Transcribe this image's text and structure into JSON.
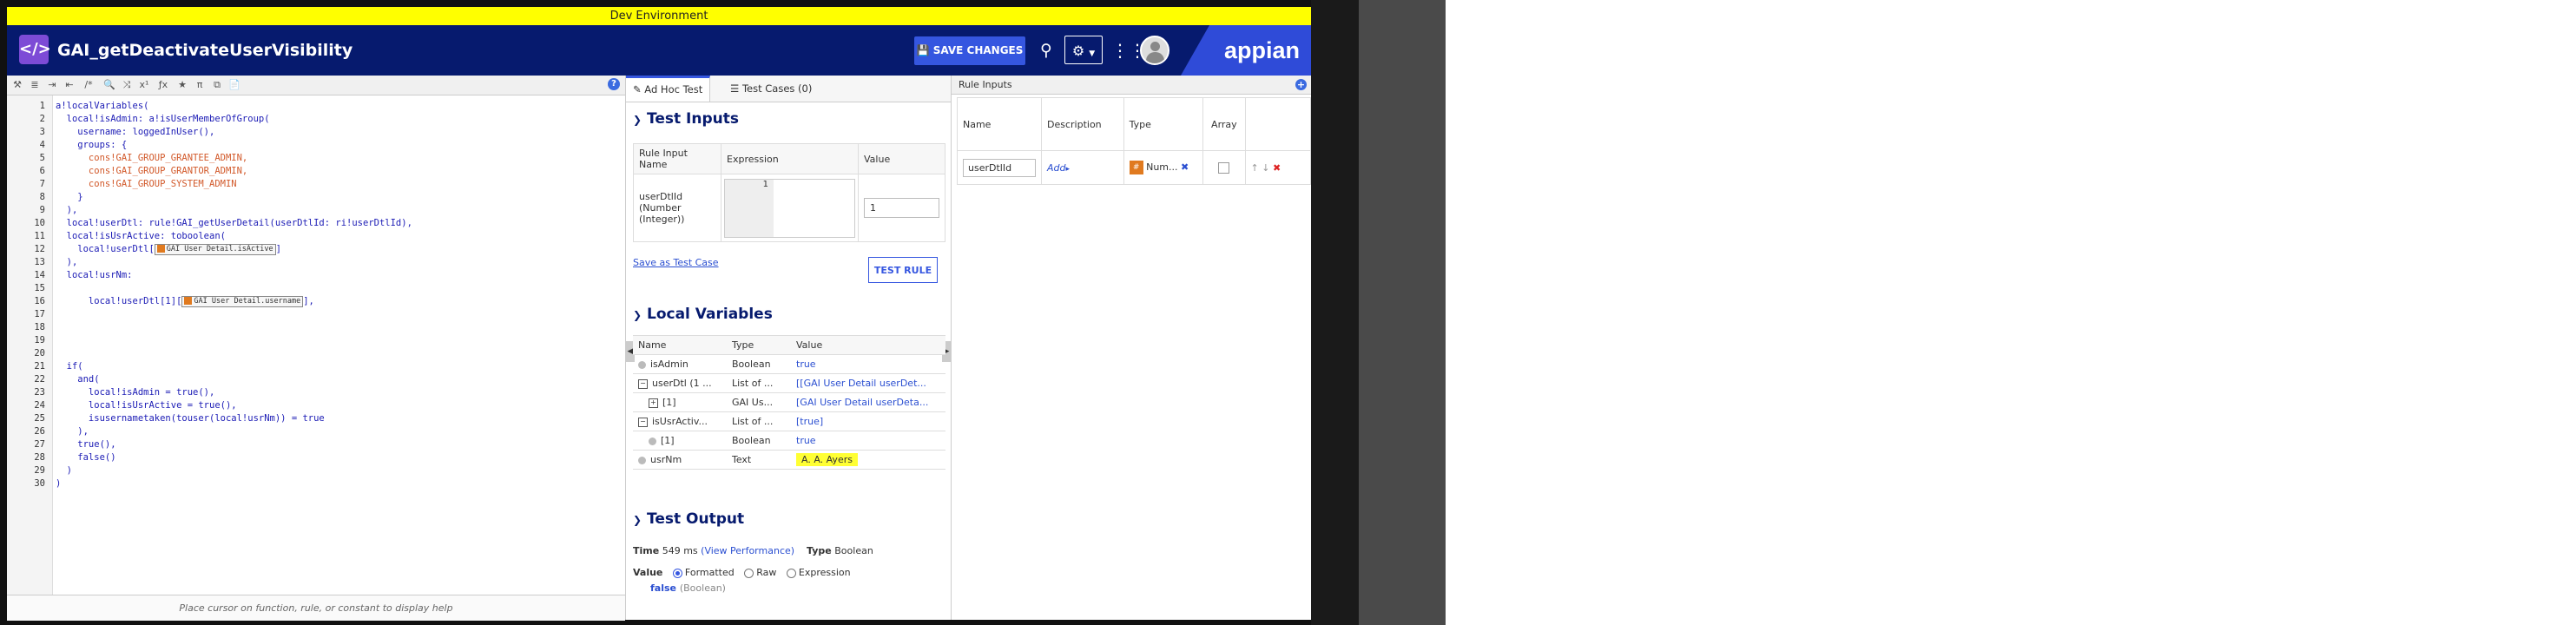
{
  "env_banner": "Dev Environment",
  "header": {
    "logo_glyph": "</>",
    "title": "GAI_getDeactivateUserVisibility",
    "save_label": "SAVE CHANGES",
    "brand": "appian",
    "colors": {
      "header_bg": "#061a6e",
      "accent": "#3556e0",
      "logo": "#7d4bd6",
      "env_banner": "#ffff00"
    }
  },
  "editor": {
    "toolbar_icons": [
      "tools-icon",
      "format-icon",
      "indent-icon",
      "outdent-icon",
      "comment-icon",
      "search-icon",
      "shuffle-icon",
      "text-size-icon",
      "function-icon",
      "star-icon",
      "pi-icon",
      "test-icon",
      "document-icon"
    ],
    "toolbar_glyphs": [
      "⚒",
      "≣",
      "⇥",
      "⇤",
      "/*",
      "🔍",
      "⤨",
      "x¹",
      "ƒx",
      "★",
      "π",
      "⧉",
      "📄"
    ],
    "help_glyph": "?",
    "line_numbers": [
      "1",
      "2",
      "3",
      "4",
      "5",
      "6",
      "7",
      "8",
      "9",
      "10",
      "11",
      "12",
      "13",
      "14",
      "15",
      "16",
      "17",
      "18",
      "19",
      "20",
      "21",
      "22",
      "23",
      "24",
      "25",
      "26",
      "27",
      "28",
      "29",
      "30"
    ],
    "lines": {
      "l1": "a!localVariables(",
      "l2": "  local!isAdmin: a!isUserMemberOfGroup(",
      "l3": "    username: loggedInUser(),",
      "l4": "    groups: {",
      "l5": "      cons!GAI_GROUP_GRANTEE_ADMIN,",
      "l6": "      cons!GAI_GROUP_GRANTOR_ADMIN,",
      "l7": "      cons!GAI_GROUP_SYSTEM_ADMIN",
      "l8": "    }",
      "l9": "  ),",
      "l10": "  local!userDtl: rule!GAI_getUserDetail(userDtlId: ri!userDtlId),",
      "l11": "  local!isUsrActive: toboolean(",
      "l12a": "    local!userDtl[",
      "l12tag": "GAI User Detail.isActive",
      "l12b": "]",
      "l13": "  ),",
      "l14": "  local!usrNm:",
      "l16a": "      local!userDtl[1][",
      "l16tag": "GAI User Detail.username",
      "l16b": "],",
      "l21": "  if(",
      "l22": "    and(",
      "l23": "      local!isAdmin = true(),",
      "l24": "      local!isUsrActive = true(),",
      "l25": "      isusernametaken(touser(local!usrNm)) = true",
      "l26": "    ),",
      "l27": "    true(),",
      "l28": "    false()",
      "l29": "  )",
      "l30": ")"
    },
    "help_text": "Place cursor on function, rule, or constant to display help"
  },
  "mid": {
    "tab_adhoc": "Ad Hoc Test",
    "tab_cases": "Test Cases (0)",
    "test_inputs_title": "Test Inputs",
    "ti_headers": {
      "name": "Rule Input Name",
      "expression": "Expression",
      "value": "Value"
    },
    "ti_row": {
      "name": "userDtlId (Number (Integer))",
      "line": "1",
      "value": "1"
    },
    "save_case": "Save as Test Case",
    "test_rule": "TEST RULE",
    "local_vars_title": "Local Variables",
    "lv_headers": {
      "name": "Name",
      "type": "Type",
      "value": "Value"
    },
    "lv_rows": [
      {
        "name": "isAdmin",
        "type": "Boolean",
        "value": "true"
      },
      {
        "name": "userDtl (1 ...",
        "type": "List of ...",
        "value": "[[GAI User Detail userDet..."
      },
      {
        "name": "[1]",
        "type": "GAI Us...",
        "value": "[GAI User Detail userDeta..."
      },
      {
        "name": "isUsrActiv...",
        "type": "List of ...",
        "value": "[true]"
      },
      {
        "name": "[1]",
        "type": "Boolean",
        "value": "true"
      },
      {
        "name": "usrNm",
        "type": "Text",
        "value": "A. A. Ayers"
      }
    ],
    "test_output_title": "Test Output",
    "time_label": "Time",
    "time_value": "549 ms",
    "view_perf": "(View Performance)",
    "type_label": "Type",
    "type_value": "Boolean",
    "value_label": "Value",
    "radio_formatted": "Formatted",
    "radio_raw": "Raw",
    "radio_expression": "Expression",
    "result_value": "false",
    "result_type": "(Boolean)"
  },
  "right": {
    "title": "Rule Inputs",
    "add_glyph": "+",
    "headers": {
      "name": "Name",
      "description": "Description",
      "type": "Type",
      "array": "Array"
    },
    "row": {
      "name": "userDtlId",
      "description": "Add",
      "type": "Num..."
    }
  }
}
